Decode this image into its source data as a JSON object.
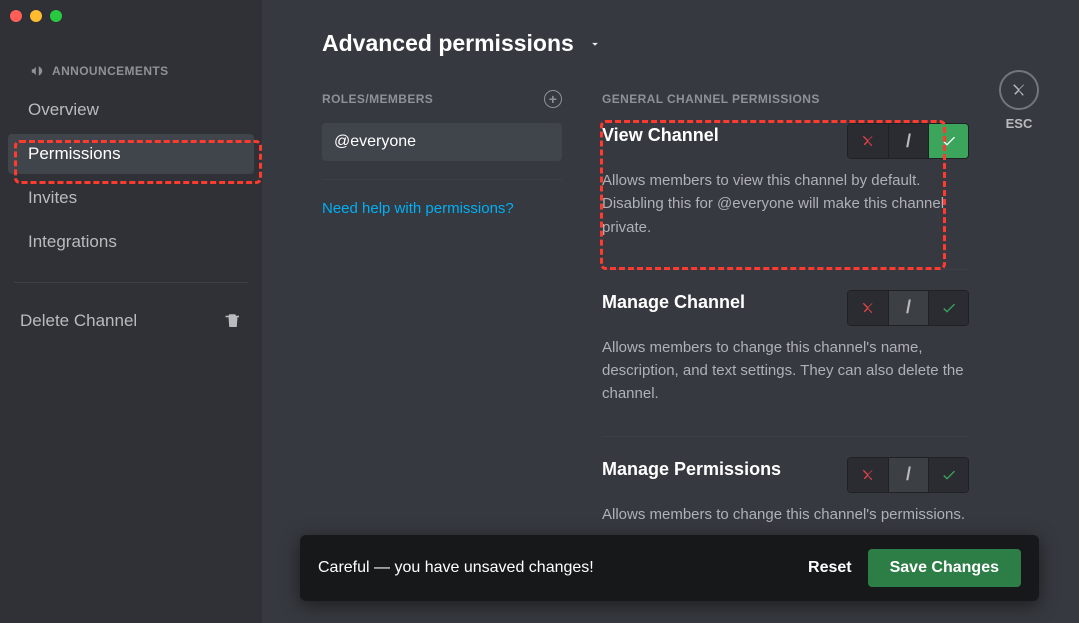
{
  "traffic_lights": [
    "close",
    "minimize",
    "maximize"
  ],
  "sidebar": {
    "section_icon": "megaphone-icon",
    "section_label": "ANNOUNCEMENTS",
    "items": [
      {
        "label": "Overview",
        "active": false
      },
      {
        "label": "Permissions",
        "active": true
      },
      {
        "label": "Invites",
        "active": false
      },
      {
        "label": "Integrations",
        "active": false
      }
    ],
    "delete_label": "Delete Channel"
  },
  "header": {
    "title": "Advanced permissions"
  },
  "esc": {
    "label": "ESC"
  },
  "roles": {
    "heading": "ROLES/MEMBERS",
    "selected": "@everyone",
    "help_link": "Need help with permissions?"
  },
  "perms": {
    "heading": "GENERAL CHANNEL PERMISSIONS",
    "items": [
      {
        "title": "View Channel",
        "desc": "Allows members to view this channel by default. Disabling this for @everyone will make this channel private.",
        "state": "allow"
      },
      {
        "title": "Manage Channel",
        "desc": "Allows members to change this channel's name, description, and text settings. They can also delete the channel.",
        "state": "neutral"
      },
      {
        "title": "Manage Permissions",
        "desc": "Allows members to change this channel's permissions.",
        "state": "neutral"
      }
    ]
  },
  "unsaved": {
    "message": "Careful — you have unsaved changes!",
    "reset": "Reset",
    "save": "Save Changes"
  },
  "colors": {
    "accent_green": "#3ba55c",
    "danger_red": "#ed4245",
    "link_blue": "#00aff4",
    "annotation_red": "#ff3b30"
  }
}
